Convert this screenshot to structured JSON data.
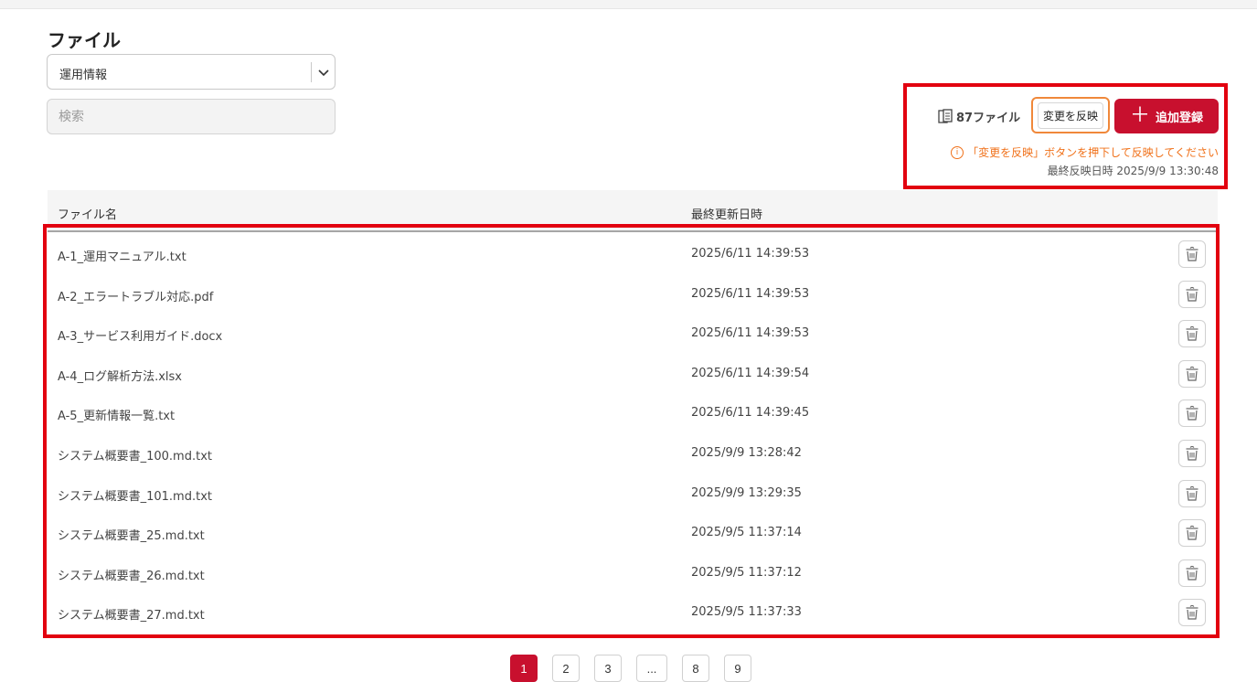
{
  "page": {
    "title": "ファイル"
  },
  "category_select": {
    "value": "運用情報"
  },
  "search": {
    "placeholder": "検索"
  },
  "toolbar": {
    "file_count": "87ファイル",
    "apply_label": "変更を反映",
    "add_label": "追加登録",
    "warning": "「変更を反映」ボタンを押下して反映してください",
    "last_applied": "最終反映日時  2025/9/9  13:30:48"
  },
  "table": {
    "headers": {
      "name": "ファイル名",
      "updated": "最終更新日時"
    },
    "rows": [
      {
        "name": "A-1_運用マニュアル.txt",
        "updated": "2025/6/11  14:39:53"
      },
      {
        "name": "A-2_エラートラブル対応.pdf",
        "updated": "2025/6/11  14:39:53"
      },
      {
        "name": "A-3_サービス利用ガイド.docx",
        "updated": "2025/6/11  14:39:53"
      },
      {
        "name": "A-4_ログ解析方法.xlsx",
        "updated": "2025/6/11  14:39:54"
      },
      {
        "name": "A-5_更新情報一覧.txt",
        "updated": "2025/6/11  14:39:45"
      },
      {
        "name": "システム概要書_100.md.txt",
        "updated": "2025/9/9  13:28:42"
      },
      {
        "name": "システム概要書_101.md.txt",
        "updated": "2025/9/9  13:29:35"
      },
      {
        "name": "システム概要書_25.md.txt",
        "updated": "2025/9/5  11:37:14"
      },
      {
        "name": "システム概要書_26.md.txt",
        "updated": "2025/9/5  11:37:12"
      },
      {
        "name": "システム概要書_27.md.txt",
        "updated": "2025/9/5  11:37:33"
      }
    ]
  },
  "pagination": {
    "pages": [
      "1",
      "2",
      "3",
      "...",
      "8",
      "9"
    ],
    "current": "1"
  },
  "colors": {
    "accent": "#c8102e",
    "highlight": "#e2000f",
    "warning": "#f0711a",
    "apply_border": "#f0883a"
  },
  "icons": {
    "file_count": "files-icon",
    "dropdown": "chevron-down-icon",
    "add": "plus-icon",
    "warning": "info-icon",
    "delete": "trash-icon"
  }
}
